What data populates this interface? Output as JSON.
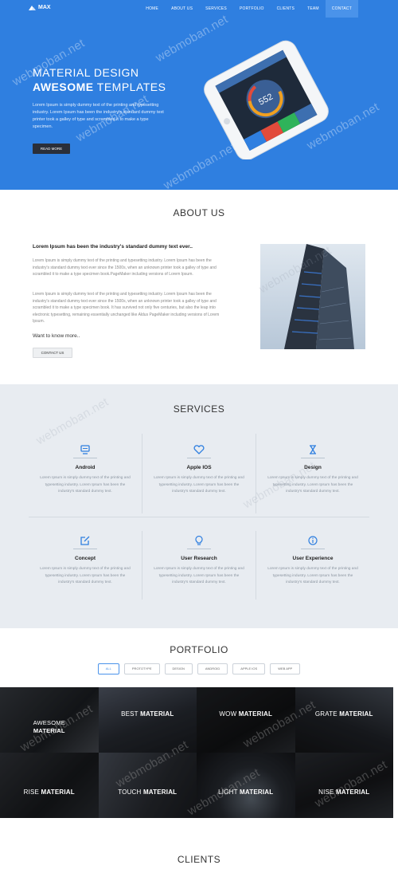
{
  "brand": {
    "name": "MAX"
  },
  "nav": {
    "items": [
      "HOME",
      "ABOUT US",
      "SERVICES",
      "PORTFOLIO",
      "CLIENTS",
      "TEAM",
      "CONTACT"
    ]
  },
  "hero": {
    "title_line1": "MATERIAL DESIGN",
    "title_bold": "AWESOME",
    "title_rest": " TEMPLATES",
    "text": "Lorem Ipsum is simply dummy text of the printing and typesetting industry. Lorem Ipsum has been the industry's standard dummy text printer took a galley of type and scrambled it to make a type specimen.",
    "button": "READ MORE",
    "phone_value": "552"
  },
  "about": {
    "title": "ABOUT US",
    "heading": "Lorem Ipsum has been the industry's standard dummy text ever..",
    "para1": "Lorem Ipsum is simply dummy text of the printing and typesetting industry. Lorem Ipsum has been the industry's standard dummy text ever since the 1500s, when an unknown printer took a galley of type and scrambled it to make a type specimen book.PageMaker including versions of Lorem Ipsum.",
    "para2": "Lorem Ipsum is simply dummy text of the printing and typesetting industry. Lorem Ipsum has been the industry's standard dummy text ever since the 1500s, when an unknown printer took a galley of type and scrambled it to make a type specimen book. It has survived not only five centuries, but also the leap into electronic typesetting, remaining essentially unchanged like Aldus PageMaker including versions of Lorem Ipsum.",
    "want": "Want to know more..",
    "button": "CONTACT US"
  },
  "services": {
    "title": "SERVICES",
    "items": [
      {
        "name": "Android",
        "icon": "monitor-icon",
        "desc": "Lorem Ipsum is simply dummy text of the printing and typesetting industry. Lorem Ipsum has been the industry's standard dummy text."
      },
      {
        "name": "Apple IOS",
        "icon": "heart-icon",
        "desc": "Lorem Ipsum is simply dummy text of the printing and typesetting industry. Lorem Ipsum has been the industry's standard dummy text."
      },
      {
        "name": "Design",
        "icon": "hourglass-icon",
        "desc": "Lorem Ipsum is simply dummy text of the printing and typesetting industry. Lorem Ipsum has been the industry's standard dummy text."
      },
      {
        "name": "Concept",
        "icon": "edit-icon",
        "desc": "Lorem Ipsum is simply dummy text of the printing and typesetting industry. Lorem Ipsum has been the industry's standard dummy text."
      },
      {
        "name": "User Research",
        "icon": "lightbulb-icon",
        "desc": "Lorem Ipsum is simply dummy text of the printing and typesetting industry. Lorem Ipsum has been the industry's standard dummy text."
      },
      {
        "name": "User Experience",
        "icon": "info-icon",
        "desc": "Lorem Ipsum is simply dummy text of the printing and typesetting industry. Lorem Ipsum has been the industry's standard dummy text."
      }
    ]
  },
  "portfolio": {
    "title": "PORTFOLIO",
    "filters": [
      "ALL",
      "PROTOTYPE",
      "DESIGN",
      "ANDROID",
      "APPLE IOS",
      "WEB APP"
    ],
    "tiles": [
      {
        "light": "AWESOME",
        "bold": "MATERIAL"
      },
      {
        "light": "BEST",
        "bold": "MATERIAL"
      },
      {
        "light": "WOW",
        "bold": "MATERIAL"
      },
      {
        "light": "GRATE",
        "bold": "MATERIAL"
      },
      {
        "light": "RISE",
        "bold": "MATERIAL"
      },
      {
        "light": "TOUCH",
        "bold": "MATERIAL"
      },
      {
        "light": "LIGHT",
        "bold": "MATERIAL"
      },
      {
        "light": "NISE",
        "bold": "MATERIAL"
      }
    ]
  },
  "clients": {
    "title": "CLIENTS"
  },
  "watermark": "webmoban.net",
  "colors": {
    "primary": "#2f7fe0",
    "services_bg": "#e8ecf1",
    "dark_button": "#2a2f3a"
  }
}
